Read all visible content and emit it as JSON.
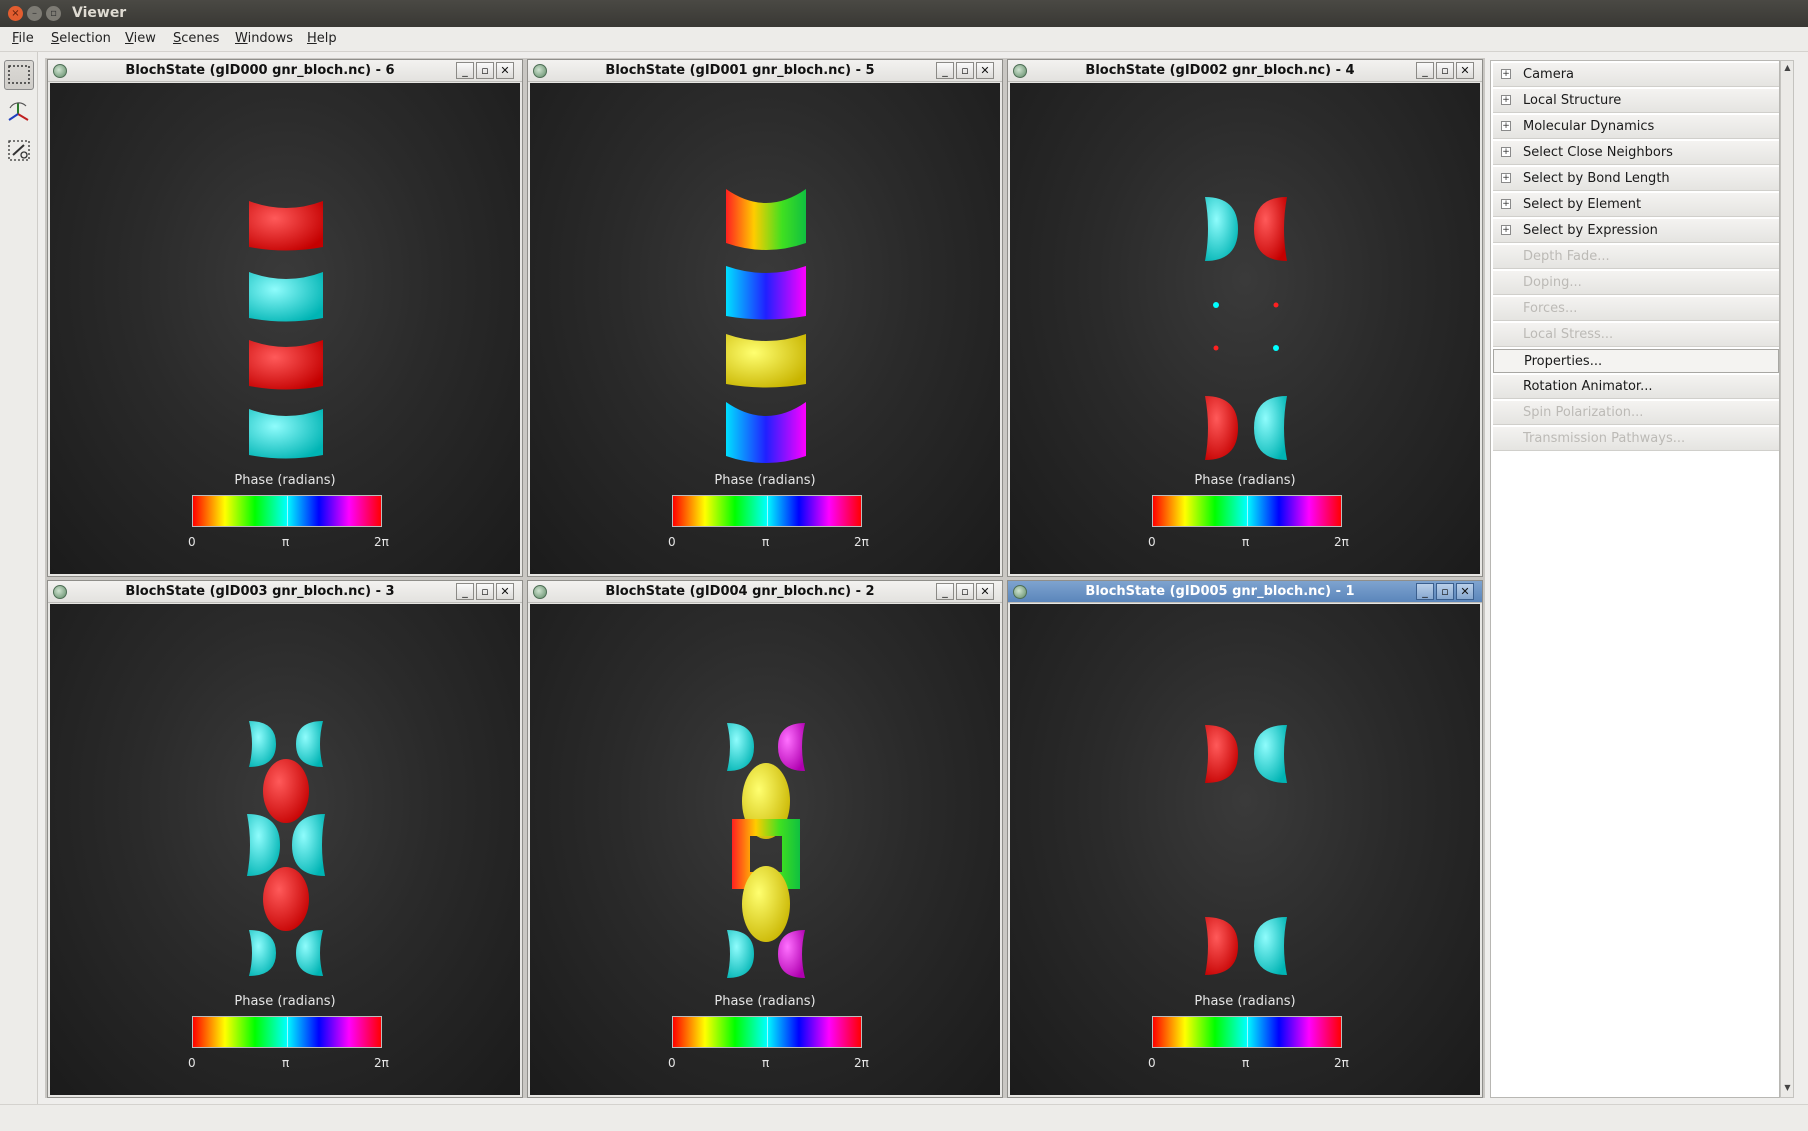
{
  "window": {
    "title": "Viewer",
    "close_glyph": "×",
    "min_glyph": "–",
    "max_glyph": "▫"
  },
  "menubar": [
    {
      "label": "File",
      "u": "F",
      "rest": "ile"
    },
    {
      "label": "Selection",
      "u": "S",
      "rest": "election"
    },
    {
      "label": "View",
      "u": "V",
      "rest": "iew"
    },
    {
      "label": "Scenes",
      "u": "S",
      "rest": "cenes"
    },
    {
      "label": "Windows",
      "u": "W",
      "rest": "indows"
    },
    {
      "label": "Help",
      "u": "H",
      "rest": "elp"
    }
  ],
  "tools": [
    "rectangle-select-icon",
    "rotate-axes-icon",
    "lasso-select-icon"
  ],
  "subwindows": [
    {
      "title": "BlochState (gID000 gnr_bloch.nc) - 6",
      "active": false,
      "scene": "lobes-stack"
    },
    {
      "title": "BlochState (gID001 gnr_bloch.nc) - 5",
      "active": false,
      "scene": "lobes-rainbow"
    },
    {
      "title": "BlochState (gID002 gnr_bloch.nc) - 4",
      "active": false,
      "scene": "half-pairs"
    },
    {
      "title": "BlochState (gID003 gnr_bloch.nc) - 3",
      "active": false,
      "scene": "cyan-red-column"
    },
    {
      "title": "BlochState (gID004 gnr_bloch.nc) - 2",
      "active": false,
      "scene": "yellow-column"
    },
    {
      "title": "BlochState (gID005 gnr_bloch.nc) - 1",
      "active": true,
      "scene": "two-pairs"
    }
  ],
  "subwindow_buttons": {
    "minimize": "_",
    "restore": "▫",
    "close": "✕"
  },
  "colorbar": {
    "title": "Phase (radians)",
    "ticks": [
      "0",
      "π",
      "2π"
    ]
  },
  "right_panel": [
    {
      "label": "Camera",
      "expandable": true,
      "enabled": true
    },
    {
      "label": "Local Structure",
      "expandable": true,
      "enabled": true
    },
    {
      "label": "Molecular Dynamics",
      "expandable": true,
      "enabled": true
    },
    {
      "label": "Select Close Neighbors",
      "expandable": true,
      "enabled": true
    },
    {
      "label": "Select by Bond Length",
      "expandable": true,
      "enabled": true
    },
    {
      "label": "Select by Element",
      "expandable": true,
      "enabled": true
    },
    {
      "label": "Select by Expression",
      "expandable": true,
      "enabled": true
    },
    {
      "label": "Depth Fade...",
      "expandable": false,
      "enabled": false
    },
    {
      "label": "Doping...",
      "expandable": false,
      "enabled": false
    },
    {
      "label": "Forces...",
      "expandable": false,
      "enabled": false
    },
    {
      "label": "Local Stress...",
      "expandable": false,
      "enabled": false
    },
    {
      "label": "Properties...",
      "expandable": false,
      "enabled": true,
      "highlight": true
    },
    {
      "label": "Rotation Animator...",
      "expandable": false,
      "enabled": true
    },
    {
      "label": "Spin Polarization...",
      "expandable": false,
      "enabled": false
    },
    {
      "label": "Transmission Pathways...",
      "expandable": false,
      "enabled": false
    }
  ],
  "expander_glyph": "+",
  "scroll_glyphs": {
    "up": "▲",
    "down": "▼"
  },
  "colors": {
    "red": "#ff1a1a",
    "cyan": "#12f0f0",
    "titlebar_active": "#5b86bb"
  }
}
